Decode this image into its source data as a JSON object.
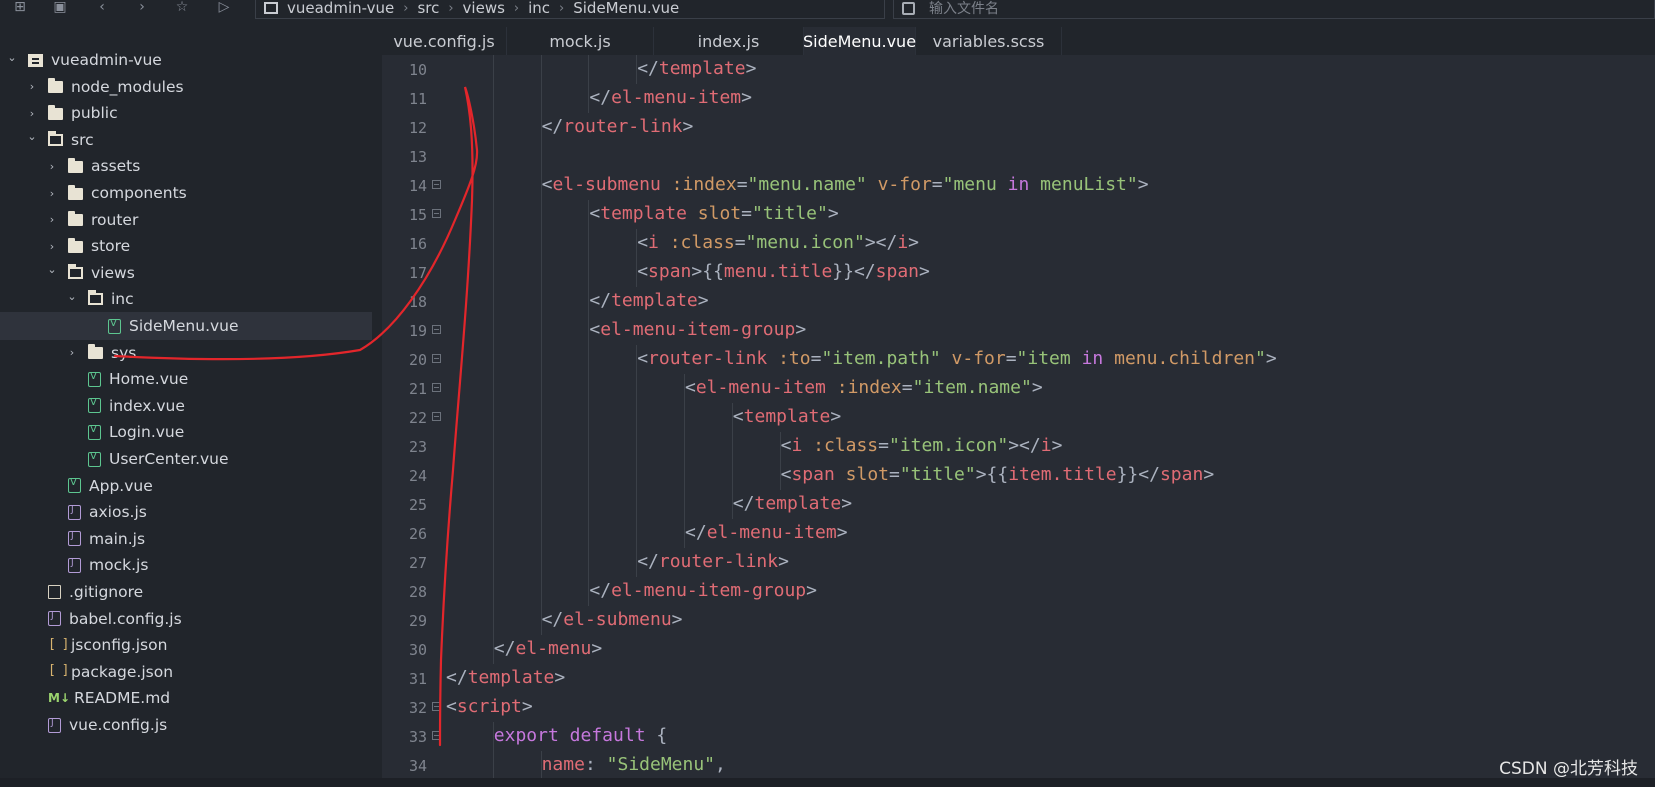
{
  "breadcrumb": [
    "vueadmin-vue",
    "src",
    "views",
    "inc",
    "SideMenu.vue"
  ],
  "search": {
    "placeholder": "输入文件名"
  },
  "tree": [
    {
      "label": "vueadmin-vue",
      "icon": "root",
      "chevron": "down",
      "depth": 0
    },
    {
      "label": "node_modules",
      "icon": "folder",
      "chevron": "right",
      "depth": 1
    },
    {
      "label": "public",
      "icon": "folder",
      "chevron": "right",
      "depth": 1
    },
    {
      "label": "src",
      "icon": "folder-open",
      "chevron": "down",
      "depth": 1
    },
    {
      "label": "assets",
      "icon": "folder",
      "chevron": "right",
      "depth": 2
    },
    {
      "label": "components",
      "icon": "folder",
      "chevron": "right",
      "depth": 2
    },
    {
      "label": "router",
      "icon": "folder",
      "chevron": "right",
      "depth": 2
    },
    {
      "label": "store",
      "icon": "folder",
      "chevron": "right",
      "depth": 2
    },
    {
      "label": "views",
      "icon": "folder-open",
      "chevron": "down",
      "depth": 2
    },
    {
      "label": "inc",
      "icon": "folder-open",
      "chevron": "down",
      "depth": 3
    },
    {
      "label": "SideMenu.vue",
      "icon": "vue",
      "chevron": "",
      "depth": 4,
      "selected": true
    },
    {
      "label": "sys",
      "icon": "folder",
      "chevron": "right",
      "depth": 3
    },
    {
      "label": "Home.vue",
      "icon": "vue",
      "chevron": "",
      "depth": 3
    },
    {
      "label": "index.vue",
      "icon": "vue",
      "chevron": "",
      "depth": 3
    },
    {
      "label": "Login.vue",
      "icon": "vue",
      "chevron": "",
      "depth": 3
    },
    {
      "label": "UserCenter.vue",
      "icon": "vue",
      "chevron": "",
      "depth": 3
    },
    {
      "label": "App.vue",
      "icon": "vue",
      "chevron": "",
      "depth": 2
    },
    {
      "label": "axios.js",
      "icon": "js",
      "chevron": "",
      "depth": 2
    },
    {
      "label": "main.js",
      "icon": "js",
      "chevron": "",
      "depth": 2
    },
    {
      "label": "mock.js",
      "icon": "js",
      "chevron": "",
      "depth": 2
    },
    {
      "label": ".gitignore",
      "icon": "plain",
      "chevron": "",
      "depth": 1
    },
    {
      "label": "babel.config.js",
      "icon": "js",
      "chevron": "",
      "depth": 1
    },
    {
      "label": "jsconfig.json",
      "icon": "json",
      "chevron": "",
      "depth": 1
    },
    {
      "label": "package.json",
      "icon": "json",
      "chevron": "",
      "depth": 1
    },
    {
      "label": "README.md",
      "icon": "md",
      "chevron": "",
      "depth": 1
    },
    {
      "label": "vue.config.js",
      "icon": "js",
      "chevron": "",
      "depth": 1
    }
  ],
  "tabs": [
    {
      "label": "vue.config.js",
      "active": false
    },
    {
      "label": "mock.js",
      "active": false
    },
    {
      "label": "index.js",
      "active": false
    },
    {
      "label": "SideMenu.vue",
      "active": true
    },
    {
      "label": "variables.scss",
      "active": false
    }
  ],
  "code_lines": [
    {
      "n": "10",
      "fold": false,
      "indent": 4,
      "tokens": [
        [
          "p",
          "</"
        ],
        [
          "t",
          "template"
        ],
        [
          "p",
          ">"
        ]
      ]
    },
    {
      "n": "11",
      "fold": false,
      "indent": 3,
      "tokens": [
        [
          "p",
          "</"
        ],
        [
          "t",
          "el-menu-item"
        ],
        [
          "p",
          ">"
        ]
      ]
    },
    {
      "n": "12",
      "fold": false,
      "indent": 2,
      "tokens": [
        [
          "p",
          "</"
        ],
        [
          "t",
          "router-link"
        ],
        [
          "p",
          ">"
        ]
      ]
    },
    {
      "n": "13",
      "fold": false,
      "indent": 2,
      "tokens": []
    },
    {
      "n": "14",
      "fold": true,
      "indent": 2,
      "tokens": [
        [
          "p",
          "<"
        ],
        [
          "t",
          "el-submenu"
        ],
        [
          "p",
          " "
        ],
        [
          "a",
          ":index"
        ],
        [
          "p",
          "="
        ],
        [
          "s",
          "\"menu.name\""
        ],
        [
          "p",
          " "
        ],
        [
          "a",
          "v-for"
        ],
        [
          "p",
          "="
        ],
        [
          "s",
          "\"menu "
        ],
        [
          "k",
          "in"
        ],
        [
          "s",
          " menuList\""
        ],
        [
          "p",
          ">"
        ]
      ]
    },
    {
      "n": "15",
      "fold": true,
      "indent": 3,
      "tokens": [
        [
          "p",
          "<"
        ],
        [
          "t",
          "template"
        ],
        [
          "p",
          " "
        ],
        [
          "a",
          "slot"
        ],
        [
          "p",
          "="
        ],
        [
          "s",
          "\"title\""
        ],
        [
          "p",
          ">"
        ]
      ]
    },
    {
      "n": "16",
      "fold": false,
      "indent": 4,
      "tokens": [
        [
          "p",
          "<"
        ],
        [
          "t",
          "i"
        ],
        [
          "p",
          " "
        ],
        [
          "a",
          ":class"
        ],
        [
          "p",
          "="
        ],
        [
          "s",
          "\"menu.icon\""
        ],
        [
          "p",
          "></"
        ],
        [
          "t",
          "i"
        ],
        [
          "p",
          ">"
        ]
      ]
    },
    {
      "n": "17",
      "fold": false,
      "indent": 4,
      "tokens": [
        [
          "p",
          "<"
        ],
        [
          "t",
          "span"
        ],
        [
          "p",
          ">{{"
        ],
        [
          "t",
          "menu.title"
        ],
        [
          "p",
          "}}</"
        ],
        [
          "t",
          "span"
        ],
        [
          "p",
          ">"
        ]
      ]
    },
    {
      "n": "18",
      "fold": false,
      "indent": 3,
      "tokens": [
        [
          "p",
          "</"
        ],
        [
          "t",
          "template"
        ],
        [
          "p",
          ">"
        ]
      ]
    },
    {
      "n": "19",
      "fold": true,
      "indent": 3,
      "tokens": [
        [
          "p",
          "<"
        ],
        [
          "t",
          "el-menu-item-group"
        ],
        [
          "p",
          ">"
        ]
      ]
    },
    {
      "n": "20",
      "fold": true,
      "indent": 4,
      "tokens": [
        [
          "p",
          "<"
        ],
        [
          "t",
          "router-link"
        ],
        [
          "p",
          " "
        ],
        [
          "a",
          ":to"
        ],
        [
          "p",
          "="
        ],
        [
          "s",
          "\"item.path\""
        ],
        [
          "p",
          " "
        ],
        [
          "a",
          "v-for"
        ],
        [
          "p",
          "="
        ],
        [
          "s",
          "\"item "
        ],
        [
          "k",
          "in"
        ],
        [
          "s",
          " "
        ],
        [
          "a",
          "menu.children"
        ],
        [
          "s",
          "\""
        ],
        [
          "p",
          ">"
        ]
      ]
    },
    {
      "n": "21",
      "fold": true,
      "indent": 5,
      "tokens": [
        [
          "p",
          "<"
        ],
        [
          "t",
          "el-menu-item"
        ],
        [
          "p",
          " "
        ],
        [
          "a",
          ":index"
        ],
        [
          "p",
          "="
        ],
        [
          "s",
          "\"item.name\""
        ],
        [
          "p",
          ">"
        ]
      ]
    },
    {
      "n": "22",
      "fold": true,
      "indent": 6,
      "tokens": [
        [
          "p",
          "<"
        ],
        [
          "t",
          "template"
        ],
        [
          "p",
          ">"
        ]
      ]
    },
    {
      "n": "23",
      "fold": false,
      "indent": 7,
      "tokens": [
        [
          "p",
          "<"
        ],
        [
          "t",
          "i"
        ],
        [
          "p",
          " "
        ],
        [
          "a",
          ":class"
        ],
        [
          "p",
          "="
        ],
        [
          "s",
          "\"item.icon\""
        ],
        [
          "p",
          "></"
        ],
        [
          "t",
          "i"
        ],
        [
          "p",
          ">"
        ]
      ]
    },
    {
      "n": "24",
      "fold": false,
      "indent": 7,
      "tokens": [
        [
          "p",
          "<"
        ],
        [
          "t",
          "span"
        ],
        [
          "p",
          " "
        ],
        [
          "a",
          "slot"
        ],
        [
          "p",
          "="
        ],
        [
          "s",
          "\"title\""
        ],
        [
          "p",
          ">{{"
        ],
        [
          "t",
          "item.title"
        ],
        [
          "p",
          "}}</"
        ],
        [
          "t",
          "span"
        ],
        [
          "p",
          ">"
        ]
      ]
    },
    {
      "n": "25",
      "fold": false,
      "indent": 6,
      "tokens": [
        [
          "p",
          "</"
        ],
        [
          "t",
          "template"
        ],
        [
          "p",
          ">"
        ]
      ]
    },
    {
      "n": "26",
      "fold": false,
      "indent": 5,
      "tokens": [
        [
          "p",
          "</"
        ],
        [
          "t",
          "el-menu-item"
        ],
        [
          "p",
          ">"
        ]
      ]
    },
    {
      "n": "27",
      "fold": false,
      "indent": 4,
      "tokens": [
        [
          "p",
          "</"
        ],
        [
          "t",
          "router-link"
        ],
        [
          "p",
          ">"
        ]
      ]
    },
    {
      "n": "28",
      "fold": false,
      "indent": 3,
      "tokens": [
        [
          "p",
          "</"
        ],
        [
          "t",
          "el-menu-item-group"
        ],
        [
          "p",
          ">"
        ]
      ]
    },
    {
      "n": "29",
      "fold": false,
      "indent": 2,
      "tokens": [
        [
          "p",
          "</"
        ],
        [
          "t",
          "el-submenu"
        ],
        [
          "p",
          ">"
        ]
      ]
    },
    {
      "n": "30",
      "fold": false,
      "indent": 1,
      "tokens": [
        [
          "p",
          "</"
        ],
        [
          "t",
          "el-menu"
        ],
        [
          "p",
          ">"
        ]
      ]
    },
    {
      "n": "31",
      "fold": false,
      "indent": 0,
      "tokens": [
        [
          "p",
          "</"
        ],
        [
          "t",
          "template"
        ],
        [
          "p",
          ">"
        ]
      ]
    },
    {
      "n": "32",
      "fold": true,
      "indent": 0,
      "tokens": [
        [
          "p",
          "<"
        ],
        [
          "t",
          "script"
        ],
        [
          "p",
          ">"
        ]
      ]
    },
    {
      "n": "33",
      "fold": true,
      "indent": 1,
      "tokens": [
        [
          "k",
          "export"
        ],
        [
          "p",
          " "
        ],
        [
          "k",
          "default"
        ],
        [
          "p",
          " {"
        ]
      ]
    },
    {
      "n": "34",
      "fold": false,
      "indent": 2,
      "tokens": [
        [
          "t",
          "name"
        ],
        [
          "p",
          ": "
        ],
        [
          "s",
          "\"SideMenu\""
        ],
        [
          "p",
          ","
        ]
      ]
    }
  ],
  "watermark": "CSDN @北芳科技",
  "colors": {
    "background": "#282c34",
    "sidebar": "#21252b",
    "tag": "#e06c75",
    "attribute": "#d19a66",
    "string": "#98c379",
    "keyword": "#c678dd",
    "annotation": "#e3262b"
  }
}
